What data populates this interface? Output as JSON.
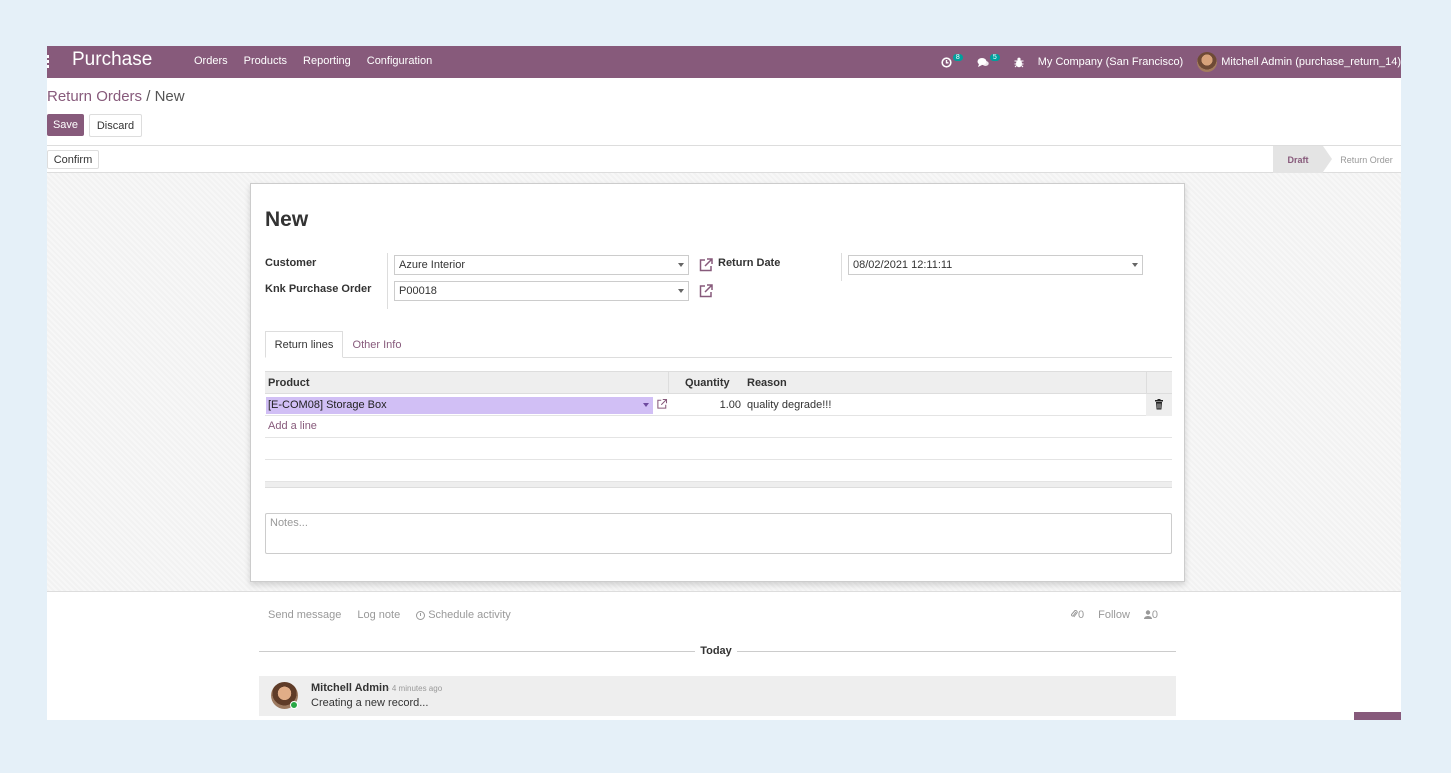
{
  "topbar": {
    "brand": "Purchase",
    "menu": [
      "Orders",
      "Products",
      "Reporting",
      "Configuration"
    ],
    "activity_count": "8",
    "message_count": "5",
    "company": "My Company (San Francisco)",
    "user": "Mitchell Admin (purchase_return_14)",
    "brand_color": "#875a7b"
  },
  "breadcrumb": {
    "parent": "Return Orders",
    "separator": " / ",
    "current": "New"
  },
  "actions": {
    "save": "Save",
    "discard": "Discard",
    "confirm": "Confirm"
  },
  "status": {
    "stages": [
      "Draft",
      "Return Order"
    ],
    "current": "Draft"
  },
  "form": {
    "title": "New",
    "customer_label": "Customer",
    "customer_value": "Azure Interior",
    "po_label": "Knk Purchase Order",
    "po_value": "P00018",
    "return_date_label": "Return Date",
    "return_date_value": "08/02/2021 12:11:11",
    "tabs": [
      "Return lines",
      "Other Info"
    ],
    "columns": {
      "product": "Product",
      "quantity": "Quantity",
      "reason": "Reason"
    },
    "lines": [
      {
        "product": "[E-COM08] Storage Box",
        "quantity": "1.00",
        "reason": "quality degrade!!!"
      }
    ],
    "add_line": "Add a line",
    "notes_placeholder": "Notes..."
  },
  "chatter": {
    "send_message": "Send message",
    "log_note": "Log note",
    "schedule_activity": "Schedule activity",
    "attachments": "0",
    "follow": "Follow",
    "followers": "0",
    "date_separator": "Today",
    "messages": [
      {
        "author": "Mitchell Admin",
        "time": "- 4 minutes ago",
        "body": "Creating a new record..."
      }
    ]
  }
}
